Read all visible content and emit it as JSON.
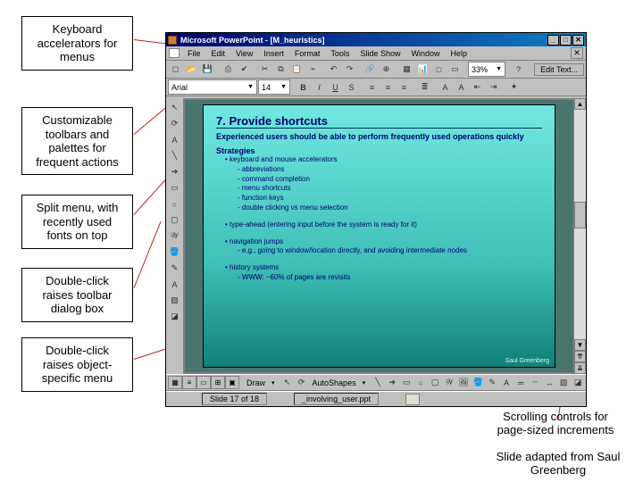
{
  "callouts": {
    "kbd": "Keyboard accelerators for menus",
    "toolbars": "Customizable toolbars and palettes for frequent actions",
    "split": "Split menu, with recently used fonts on top",
    "dblclick_tb": "Double-click raises toolbar dialog box",
    "dblclick_obj": "Double-click raises object-specific menu",
    "scroll": "Scrolling controls for page-sized increments",
    "adapted": "Slide adapted from Saul Greenberg"
  },
  "title": "Microsoft PowerPoint - [M_heuristics]",
  "menu": [
    "File",
    "Edit",
    "View",
    "Insert",
    "Format",
    "Tools",
    "Slide Show",
    "Window",
    "Help"
  ],
  "toolbar2": {
    "edit_text": "Edit Text..."
  },
  "format": {
    "font": "Arial",
    "size": "14"
  },
  "zoom": "33%",
  "slide": {
    "title": "7. Provide shortcuts",
    "exp": "Experienced users should be able to perform frequently used operations quickly",
    "strat": "Strategies",
    "s1": "keyboard and mouse accelerators",
    "s1a": "abbreviations",
    "s1b": "command completion",
    "s1c": "menu shortcuts",
    "s1d": "function keys",
    "s1e": "double clicking vs menu selection",
    "s2": "type-ahead (entering input before the system is ready for it)",
    "s3": "navigation jumps",
    "s3a": "e.g., going to window/location directly, and avoiding intermediate nodes",
    "s4": "history systems",
    "s4a": "WWW: ~60% of pages are revisits",
    "credit": "Saul Greenberg"
  },
  "draw": {
    "draw": "Draw",
    "autoshapes": "AutoShapes"
  },
  "status": {
    "slide": "Slide 17 of 18",
    "file": "_involving_user.ppt"
  },
  "icons": {
    "new": "◻",
    "open": "📂",
    "save": "💾",
    "print": "⎙",
    "spell": "✔",
    "cut": "✂",
    "copy": "⧉",
    "paste": "📋",
    "fmt": "⌁",
    "undo": "↶",
    "redo": "↷",
    "link": "🔗",
    "web": "⊕",
    "tbl": "▦",
    "chart": "📊",
    "newslide": "□",
    "layout": "▭",
    "bold": "B",
    "italic": "I",
    "under": "U",
    "shadow": "S",
    "alignl": "≡",
    "alignc": "≡",
    "alignr": "≡",
    "bullet": "≣",
    "inc": "A",
    "dec": "A",
    "promote": "⇤",
    "demote": "⇥",
    "anim": "✦",
    "sel": "↖",
    "rot": "⟳",
    "atxt": "A",
    "line": "╲",
    "arrow": "➔",
    "rect": "▭",
    "oval": "○",
    "txtbox": "▢",
    "wart": "𝒲",
    "clip": "🖼",
    "fill": "🪣",
    "linec": "✎",
    "fontc": "A",
    "lines": "═",
    "dash": "┄",
    "arrows": "↔",
    "shad": "▧",
    "3d": "◪",
    "up": "▲",
    "down": "▼",
    "pgup": "⇈",
    "pgdn": "⇊"
  }
}
